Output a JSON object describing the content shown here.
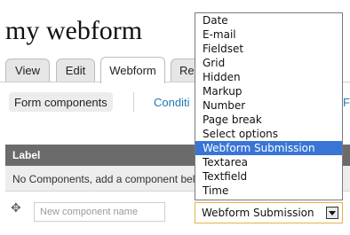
{
  "page": {
    "title": "my webform"
  },
  "tabs": [
    {
      "label": "View",
      "active": false
    },
    {
      "label": "Edit",
      "active": false
    },
    {
      "label": "Webform",
      "active": true
    },
    {
      "label": "Re",
      "active": false
    }
  ],
  "subtabs": {
    "active": "Form components",
    "link1": "Conditi",
    "link2": "Fo"
  },
  "table": {
    "header_label": "Label",
    "empty_message": "No Components, add a component below."
  },
  "new_component": {
    "placeholder": "New component name",
    "type_selected": "Webform Submission"
  },
  "dropdown": {
    "options": [
      "Date",
      "E-mail",
      "Fieldset",
      "Grid",
      "Hidden",
      "Markup",
      "Number",
      "Page break",
      "Select options",
      "Webform Submission",
      "Textarea",
      "Textfield",
      "Time"
    ],
    "highlighted": "Webform Submission"
  },
  "colors": {
    "highlight": "#3875d7",
    "table_header": "#6b6b6b",
    "link": "#1f78b4",
    "focus_border": "#e2b34a"
  }
}
